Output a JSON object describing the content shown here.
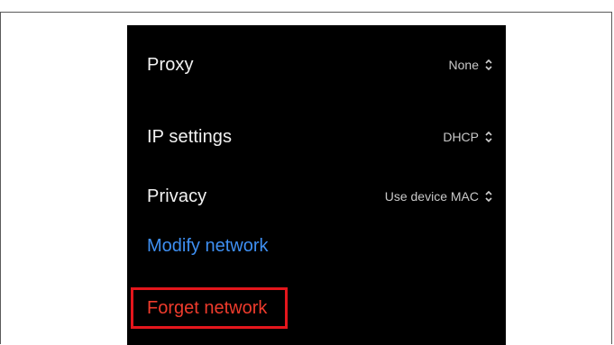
{
  "settings": {
    "proxy": {
      "label": "Proxy",
      "value": "None"
    },
    "ip_settings": {
      "label": "IP settings",
      "value": "DHCP"
    },
    "privacy": {
      "label": "Privacy",
      "value": "Use device MAC"
    }
  },
  "actions": {
    "modify_network": "Modify network",
    "forget_network": "Forget network"
  },
  "colors": {
    "background": "#000000",
    "link_blue": "#3e8ff2",
    "danger_red": "#ef3b2c",
    "highlight_box": "#e4161c"
  },
  "icons": {
    "dropdown": "up-down-chevron-icon"
  }
}
